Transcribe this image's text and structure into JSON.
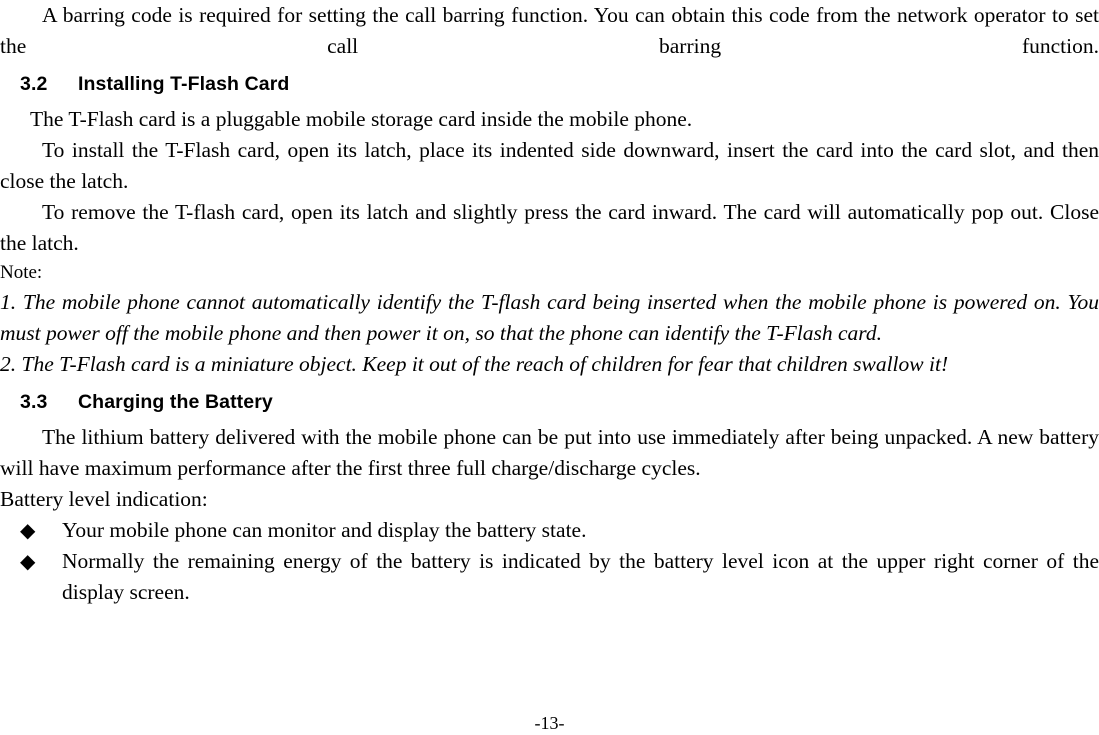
{
  "document": {
    "page_number": "-13-"
  },
  "content": {
    "intro_paragraph": "A barring code is required for setting the call barring function. You can obtain this code from the network operator to set the call barring function.",
    "section_32": {
      "number": "3.2",
      "title": "Installing T-Flash Card",
      "paragraphs": [
        "The T-Flash card is a pluggable mobile storage card inside the mobile phone.",
        "To install the T-Flash card, open its latch, place its indented side downward, insert the card into the card slot, and then close the latch.",
        "To remove the T-flash card, open its latch and slightly press the card inward. The card will automatically pop out. Close the latch."
      ],
      "note_label": "Note:",
      "notes": [
        "1. The mobile phone cannot automatically identify the T-flash card being inserted when the mobile phone is powered on. You must power off the mobile phone and then power it on, so that the phone can identify the T-Flash card.",
        "2. The T-Flash card is a miniature object. Keep it out of the reach of children for fear that children swallow it!"
      ]
    },
    "section_33": {
      "number": "3.3",
      "title": "Charging the Battery",
      "paragraphs": [
        "The lithium battery delivered with the mobile phone can be put into use immediately after being unpacked. A new battery will have maximum performance after the first three full charge/discharge cycles.",
        "Battery level indication:"
      ],
      "bullet_glyph": "◆",
      "bullets": [
        "Your mobile phone can monitor and display the battery state.",
        "Normally the remaining energy of the battery is indicated by the battery level icon at the upper right corner of the display screen."
      ]
    }
  }
}
